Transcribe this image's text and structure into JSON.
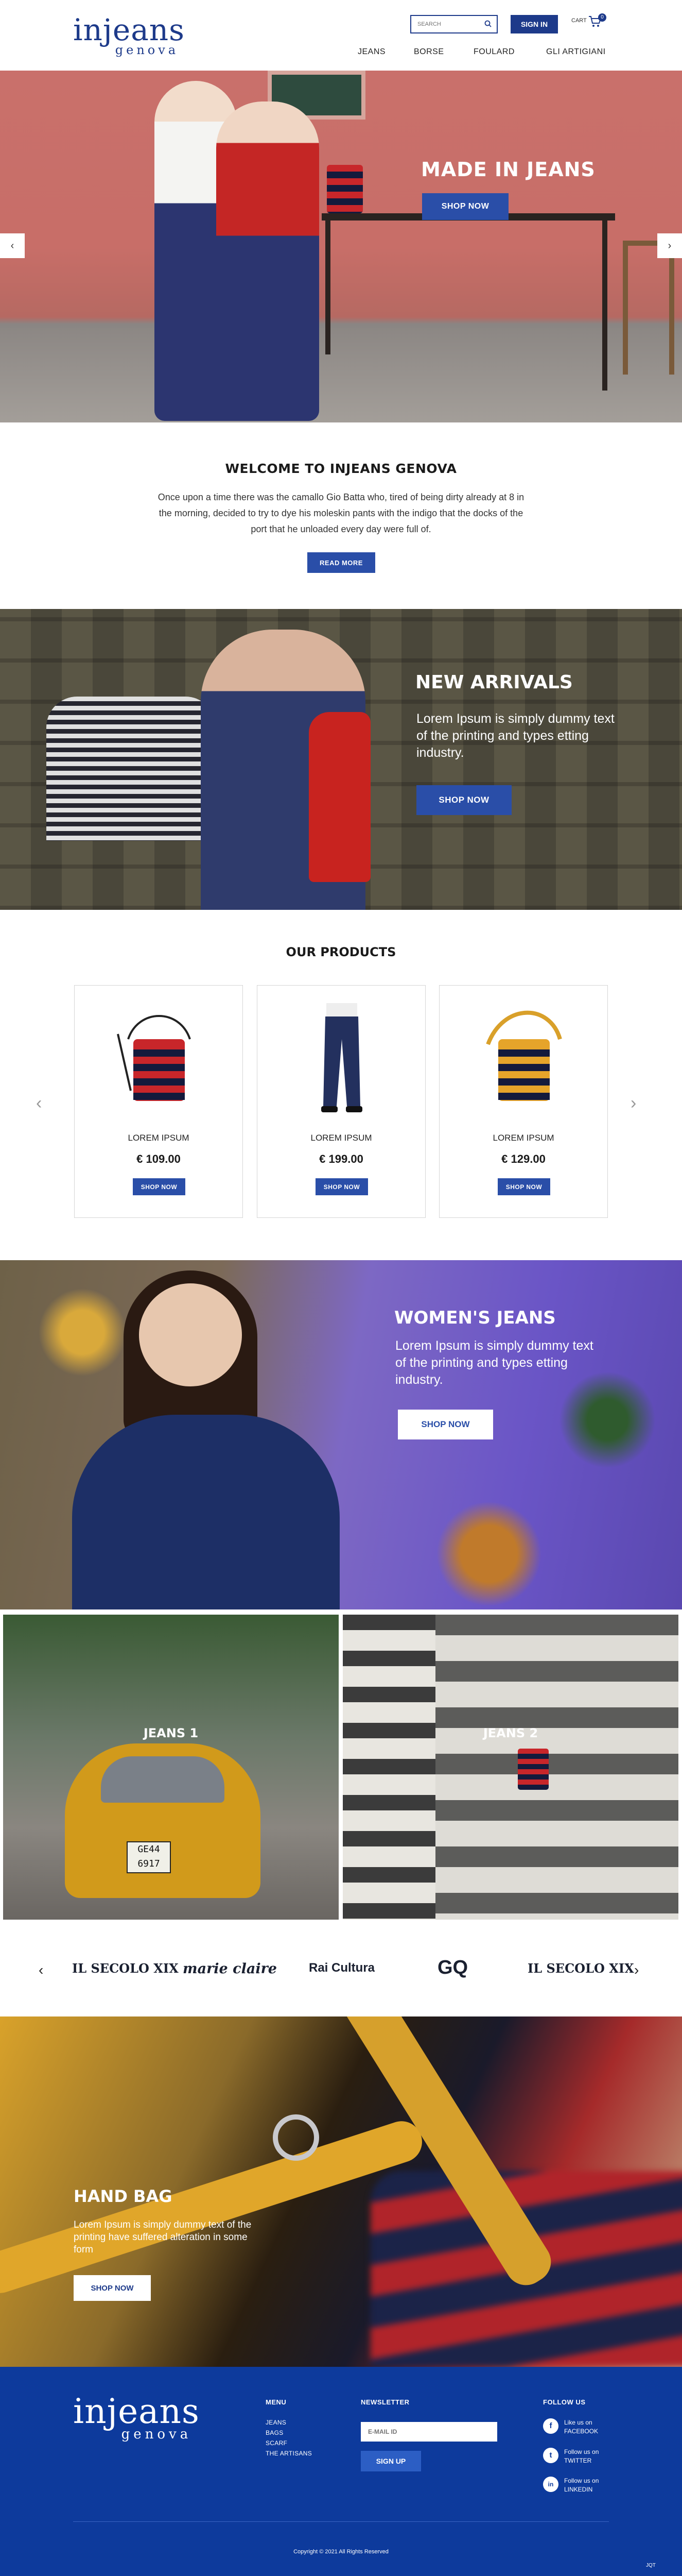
{
  "header": {
    "logo_line1": "injeans",
    "logo_line2": "genova",
    "search_placeholder": "SEARCH",
    "signin_label": "SIGN IN",
    "cart_label": "CART",
    "cart_count": "0",
    "nav": [
      "JEANS",
      "BORSE",
      "FOULARD",
      "GLI ARTIGIANI"
    ]
  },
  "hero": {
    "title": "MADE IN JEANS",
    "button": "SHOP NOW",
    "prev": "‹",
    "next": "›"
  },
  "welcome": {
    "title": "WELCOME TO INJEANS GENOVA",
    "text": "Once upon a time there was the camallo Gio Batta who, tired of being dirty already at 8 in the morning, decided to try to dye his moleskin pants with the indigo that the docks of the port that he unloaded every day were full of.",
    "button": "READ MORE"
  },
  "arrivals": {
    "title": "NEW ARRIVALS",
    "text": "Lorem Ipsum is simply dummy text of the printing and types etting industry.",
    "button": "SHOP NOW"
  },
  "products": {
    "title": "OUR PRODUCTS",
    "prev": "‹",
    "next": "›",
    "items": [
      {
        "name": "LOREM IPSUM",
        "price": "€ 109.00",
        "button": "SHOP NOW",
        "image": "bucket-bag-red-navy"
      },
      {
        "name": "LOREM IPSUM",
        "price": "€ 199.00",
        "button": "SHOP NOW",
        "image": "jeans-trousers"
      },
      {
        "name": "LOREM IPSUM",
        "price": "€ 129.00",
        "button": "SHOP NOW",
        "image": "bucket-bag-yellow-navy"
      }
    ]
  },
  "women": {
    "title": "WOMEN'S JEANS",
    "text": "Lorem Ipsum is simply dummy text of the printing and types etting industry.",
    "button": "SHOP NOW"
  },
  "jeans_tiles": [
    {
      "label": "JEANS 1",
      "plate": "GE44 6917"
    },
    {
      "label": "JEANS 2"
    }
  ],
  "press": {
    "prev": "‹",
    "next": "›",
    "logos": [
      "IL SECOLO XIX",
      "marie claire",
      "Rai Cultura",
      "GQ",
      "IL SECOLO XIX"
    ]
  },
  "handbag": {
    "title": "HAND BAG",
    "text": "Lorem Ipsum is simply dummy text of the printing have suffered alteration in some form",
    "button": "SHOP NOW"
  },
  "footer": {
    "logo_line1": "injeans",
    "logo_line2": "genova",
    "menu_title": "MENU",
    "menu_items": [
      "JEANS",
      "BAGS",
      "SCARF",
      "THE ARTISANS"
    ],
    "newsletter_title": "NEWSLETTER",
    "email_placeholder": "E-MAIL ID",
    "signup": "SIGN UP",
    "follow_title": "FOLLOW US",
    "social": [
      {
        "icon": "facebook-icon",
        "glyph": "f",
        "line1": "Like us on",
        "line2": "FACEBOOK"
      },
      {
        "icon": "twitter-icon",
        "glyph": "t",
        "line1": "Follow us on",
        "line2": "TWITTER"
      },
      {
        "icon": "linkedin-icon",
        "glyph": "in",
        "line1": "Follow us on",
        "line2": "LINKEDIN"
      }
    ],
    "copyright": "Copyright © 2021 All Rights Reserved",
    "badge": "JQT"
  },
  "colors": {
    "brand": "#1d3a8a",
    "button": "#2a4ea8",
    "footer": "#0d3a9c"
  }
}
